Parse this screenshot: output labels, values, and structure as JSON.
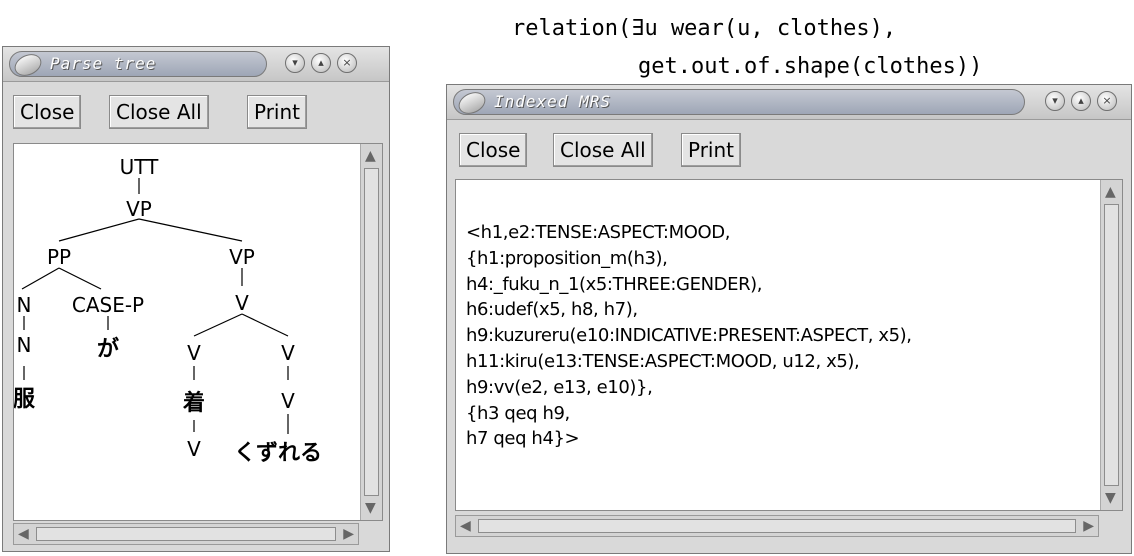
{
  "formula": {
    "line1": "relation(∃u wear(u, clothes),",
    "line2": "get.out.of.shape(clothes))"
  },
  "parse_window": {
    "title": "Parse tree",
    "buttons": {
      "close": "Close",
      "close_all": "Close All",
      "print": "Print"
    },
    "tree": {
      "nodes": {
        "utt": "UTT",
        "vp_top": "VP",
        "pp": "PP",
        "vp_right": "VP",
        "n_top": "N",
        "case_p": "CASE-P",
        "v_mid": "V",
        "n_bottom": "N",
        "v_left": "V",
        "v_right": "V",
        "v_left_bottom": "V",
        "v_right_bottom": "V"
      },
      "words": {
        "fuku": "服",
        "ga": "が",
        "ki": "着",
        "kuzureru": "くずれる"
      }
    }
  },
  "mrs_window": {
    "title": "Indexed MRS",
    "buttons": {
      "close": "Close",
      "close_all": "Close All",
      "print": "Print"
    },
    "lines": [
      "<h1,e2:TENSE:ASPECT:MOOD,",
      "{h1:proposition_m(h3),",
      "h4:_fuku_n_1(x5:THREE:GENDER),",
      "h6:udef(x5, h8, h7),",
      "h9:kuzureru(e10:INDICATIVE:PRESENT:ASPECT, x5),",
      "h11:kiru(e13:TENSE:ASPECT:MOOD, u12, x5),",
      "h9:vv(e2, e13, e10)},",
      "{h3 qeq h9,",
      "h7 qeq h4}>"
    ]
  },
  "window_controls": {
    "minimize": "▾",
    "maximize": "▴",
    "close": "×"
  }
}
